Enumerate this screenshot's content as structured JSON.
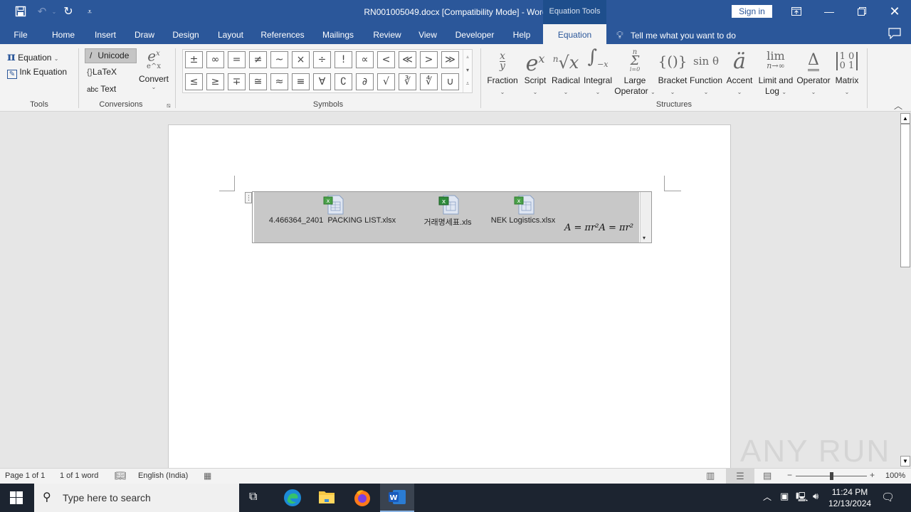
{
  "window": {
    "title": "RN001005049.docx [Compatibility Mode]  -  Word",
    "context_tab_group": "Equation Tools",
    "sign_in": "Sign in",
    "icons": [
      "save-icon",
      "undo-icon",
      "redo-icon",
      "customize-qat-icon",
      "ribbon-display-options-icon",
      "minimize-icon",
      "restore-icon",
      "close-icon"
    ]
  },
  "tabs": [
    {
      "label": "File"
    },
    {
      "label": "Home"
    },
    {
      "label": "Insert"
    },
    {
      "label": "Draw"
    },
    {
      "label": "Design"
    },
    {
      "label": "Layout"
    },
    {
      "label": "References"
    },
    {
      "label": "Mailings"
    },
    {
      "label": "Review"
    },
    {
      "label": "View"
    },
    {
      "label": "Developer"
    },
    {
      "label": "Help"
    },
    {
      "label": "Equation",
      "active": true
    }
  ],
  "tell_me": "Tell me what you want to do",
  "ribbon": {
    "tools": {
      "label": "Tools",
      "equation": "Equation",
      "ink_equation": "Ink Equation"
    },
    "conversions": {
      "label": "Conversions",
      "unicode": "Unicode",
      "latex": "LaTeX",
      "text": "Text",
      "convert": "Convert"
    },
    "symbols": {
      "label": "Symbols",
      "row1": [
        "±",
        "∞",
        "=",
        "≠",
        "~",
        "×",
        "÷",
        "!",
        "∝",
        "<",
        "≪",
        ">",
        "≫"
      ],
      "row2": [
        "≤",
        "≥",
        "∓",
        "≅",
        "≈",
        "≡",
        "∀",
        "∁",
        "∂",
        "√",
        "∛",
        "∜",
        "∪"
      ]
    },
    "structures": {
      "label": "Structures",
      "items": [
        {
          "label": "Fraction",
          "label2": ""
        },
        {
          "label": "Script",
          "label2": ""
        },
        {
          "label": "Radical",
          "label2": ""
        },
        {
          "label": "Integral",
          "label2": ""
        },
        {
          "label": "Large",
          "label2": "Operator"
        },
        {
          "label": "Bracket",
          "label2": ""
        },
        {
          "label": "Function",
          "label2": ""
        },
        {
          "label": "Accent",
          "label2": ""
        },
        {
          "label": "Limit and",
          "label2": "Log"
        },
        {
          "label": "Operator",
          "label2": ""
        },
        {
          "label": "Matrix",
          "label2": ""
        }
      ]
    }
  },
  "document": {
    "embedded_files": [
      {
        "name": "4.466364_2401  PACKING LIST.xlsx"
      },
      {
        "name": "거래명세표.xls"
      },
      {
        "name": "NEK Logistics.xlsx"
      }
    ],
    "equation_text": "A = πr²A = πr²"
  },
  "status_bar": {
    "page": "Page 1 of 1",
    "words": "1 of 1 word",
    "language": "English (India)",
    "zoom": "100%",
    "zoom_level_percent": 100
  },
  "taskbar": {
    "search_placeholder": "Type here to search",
    "time": "11:24 PM",
    "date": "12/13/2024",
    "apps": [
      "task-view",
      "edge",
      "file-explorer",
      "firefox",
      "word"
    ]
  },
  "watermark": "ANY RUN"
}
